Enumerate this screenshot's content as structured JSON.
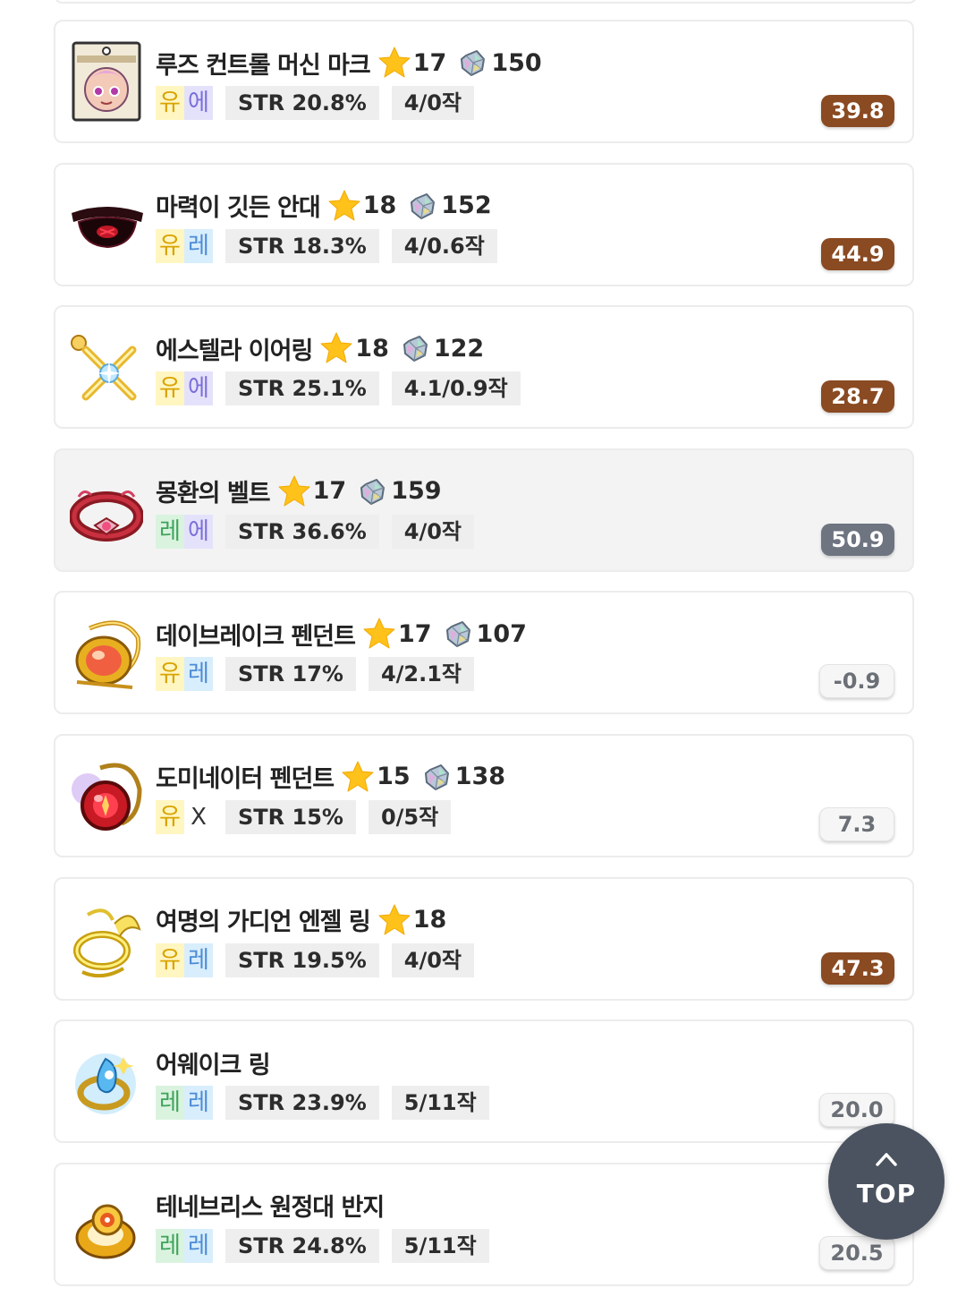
{
  "items": [
    {
      "name": "루즈 컨트롤 머신 마크",
      "icon": "machine-mark-icon",
      "star": "17",
      "gem": "150",
      "potential": [
        {
          "text": "유",
          "color": "yellow"
        },
        {
          "text": "에",
          "color": "purple"
        }
      ],
      "stat": "STR 20.8%",
      "scroll": "4/0작",
      "score": "39.8",
      "score_style": "brown",
      "highlight": false
    },
    {
      "name": "마력이 깃든 안대",
      "icon": "eyepatch-icon",
      "star": "18",
      "gem": "152",
      "potential": [
        {
          "text": "유",
          "color": "yellow"
        },
        {
          "text": "레",
          "color": "blue"
        }
      ],
      "stat": "STR 18.3%",
      "scroll": "4/0.6작",
      "score": "44.9",
      "score_style": "brown",
      "highlight": false
    },
    {
      "name": "에스텔라 이어링",
      "icon": "earring-icon",
      "star": "18",
      "gem": "122",
      "potential": [
        {
          "text": "유",
          "color": "yellow"
        },
        {
          "text": "에",
          "color": "purple"
        }
      ],
      "stat": "STR 25.1%",
      "scroll": "4.1/0.9작",
      "score": "28.7",
      "score_style": "brown",
      "highlight": false
    },
    {
      "name": "몽환의 벨트",
      "icon": "belt-icon",
      "star": "17",
      "gem": "159",
      "potential": [
        {
          "text": "레",
          "color": "green"
        },
        {
          "text": "에",
          "color": "purple"
        }
      ],
      "stat": "STR 36.6%",
      "scroll": "4/0작",
      "score": "50.9",
      "score_style": "gray",
      "highlight": true
    },
    {
      "name": "데이브레이크 펜던트",
      "icon": "pendant-gold-icon",
      "star": "17",
      "gem": "107",
      "potential": [
        {
          "text": "유",
          "color": "yellow"
        },
        {
          "text": "레",
          "color": "blue"
        }
      ],
      "stat": "STR 17%",
      "scroll": "4/2.1작",
      "score": "-0.9",
      "score_style": "light",
      "highlight": false
    },
    {
      "name": "도미네이터 펜던트",
      "icon": "pendant-red-icon",
      "star": "15",
      "gem": "138",
      "potential": [
        {
          "text": "유",
          "color": "yellow"
        },
        {
          "text": "X",
          "color": "none"
        }
      ],
      "stat": "STR 15%",
      "scroll": "0/5작",
      "score": "7.3",
      "score_style": "light",
      "highlight": false
    },
    {
      "name": "여명의 가디언 엔젤 링",
      "icon": "angel-ring-icon",
      "star": "18",
      "gem": "",
      "potential": [
        {
          "text": "유",
          "color": "yellow"
        },
        {
          "text": "레",
          "color": "blue"
        }
      ],
      "stat": "STR 19.5%",
      "scroll": "4/0작",
      "score": "47.3",
      "score_style": "brown",
      "highlight": false
    },
    {
      "name": "어웨이크 링",
      "icon": "awake-ring-icon",
      "star": "",
      "gem": "",
      "potential": [
        {
          "text": "레",
          "color": "green"
        },
        {
          "text": "레",
          "color": "blue"
        }
      ],
      "stat": "STR 23.9%",
      "scroll": "5/11작",
      "score": "20.0",
      "score_style": "light",
      "highlight": false
    },
    {
      "name": "테네브리스 원정대 반지",
      "icon": "tenebris-ring-icon",
      "star": "",
      "gem": "",
      "potential": [
        {
          "text": "레",
          "color": "green"
        },
        {
          "text": "레",
          "color": "blue"
        }
      ],
      "stat": "STR 24.8%",
      "scroll": "5/11작",
      "score": "20.5",
      "score_style": "light",
      "highlight": false
    }
  ],
  "top_button": {
    "label": "TOP"
  },
  "colors": {
    "score_brown": "#8a4a22",
    "score_gray": "#6e7480",
    "star": "#ffc21a",
    "top_button": "#4b5360"
  }
}
